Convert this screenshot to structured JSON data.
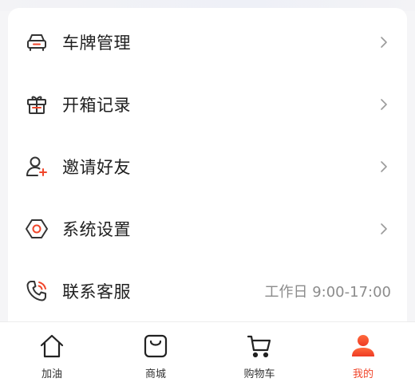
{
  "menu": {
    "items": [
      {
        "label": "车牌管理",
        "icon": "car-plate-icon"
      },
      {
        "label": "开箱记录",
        "icon": "gift-box-icon"
      },
      {
        "label": "邀请好友",
        "icon": "add-friend-icon"
      },
      {
        "label": "系统设置",
        "icon": "settings-hexagon-icon"
      },
      {
        "label": "联系客服",
        "icon": "phone-icon",
        "extra": "工作日 9:00-17:00"
      }
    ]
  },
  "tabbar": {
    "tabs": [
      {
        "label": "加油",
        "icon": "home-icon"
      },
      {
        "label": "商城",
        "icon": "shopping-bag-icon"
      },
      {
        "label": "购物车",
        "icon": "cart-icon"
      },
      {
        "label": "我的",
        "icon": "user-icon",
        "active": true
      }
    ]
  },
  "colors": {
    "accent": "#f0462b",
    "icon_dark": "#333333",
    "text_primary": "#1f1f1f",
    "text_secondary": "#8c8c8c"
  }
}
